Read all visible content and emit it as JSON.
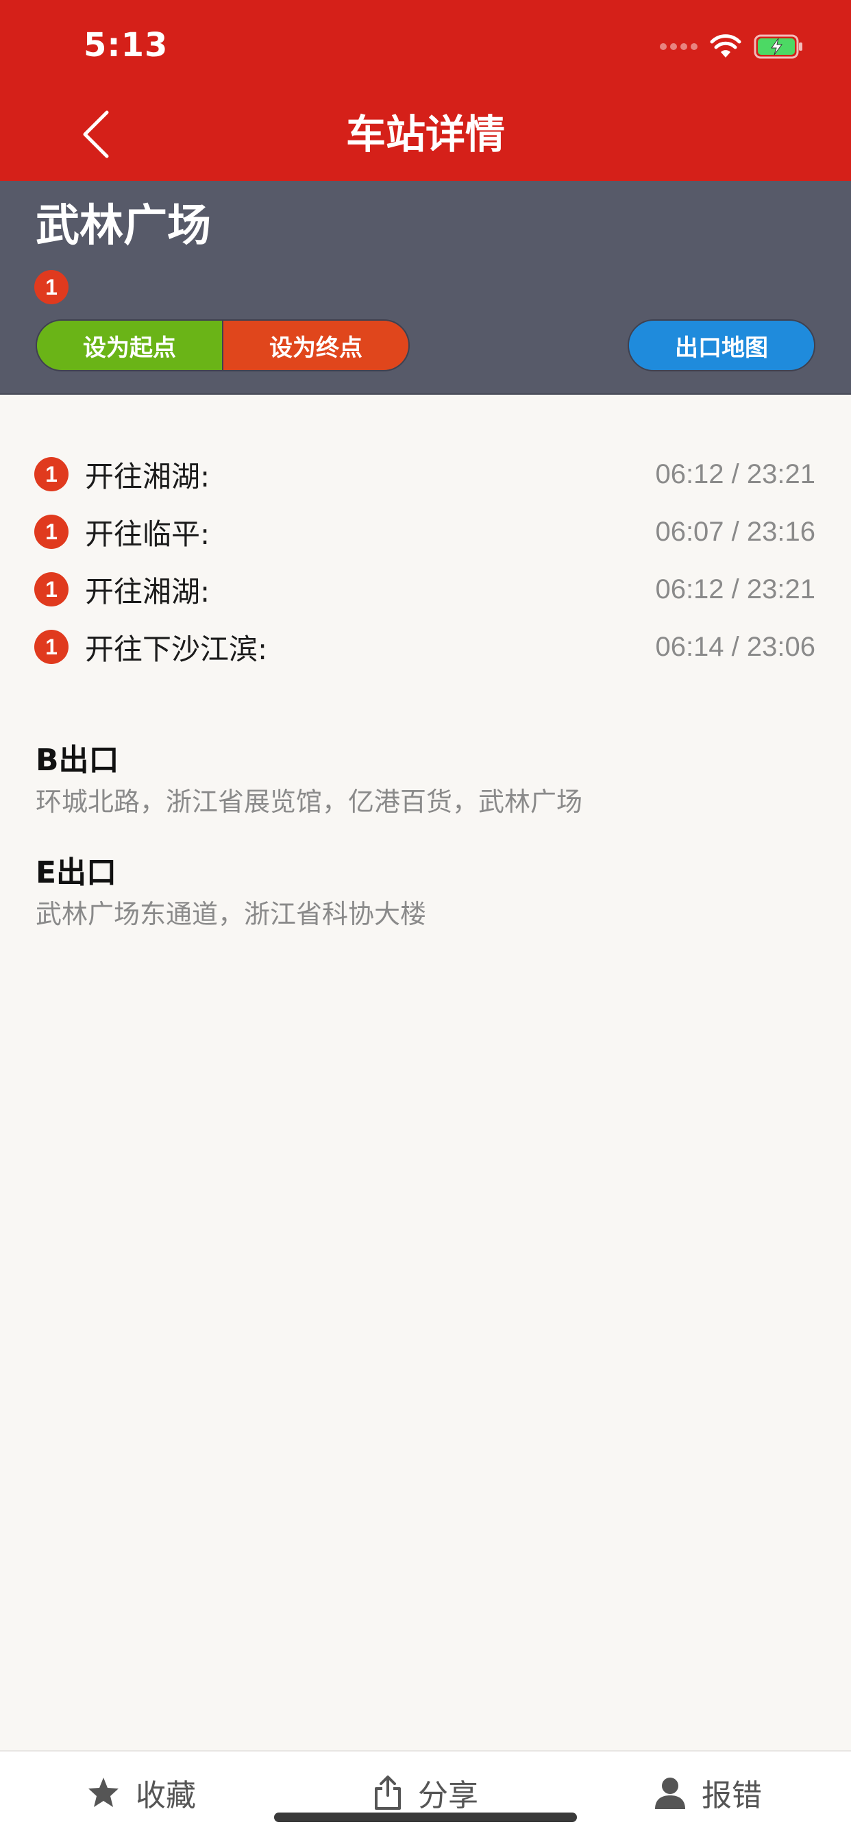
{
  "status_bar": {
    "time": "5:13"
  },
  "nav": {
    "title": "车站详情"
  },
  "station": {
    "name": "武林广场",
    "line_number": "1",
    "set_start_label": "设为起点",
    "set_end_label": "设为终点",
    "exit_map_label": "出口地图"
  },
  "schedule": [
    {
      "line": "1",
      "direction": "开往湘湖:",
      "times": "06:12 / 23:21"
    },
    {
      "line": "1",
      "direction": "开往临平:",
      "times": "06:07 / 23:16"
    },
    {
      "line": "1",
      "direction": "开往湘湖:",
      "times": "06:12 / 23:21"
    },
    {
      "line": "1",
      "direction": "开往下沙江滨:",
      "times": "06:14 / 23:06"
    }
  ],
  "exits": [
    {
      "name": "B出口",
      "description": "环城北路，浙江省展览馆，亿港百货，武林广场"
    },
    {
      "name": "E出口",
      "description": "武林广场东通道，浙江省科协大楼"
    }
  ],
  "tabbar": {
    "favorite_label": "收藏",
    "share_label": "分享",
    "report_label": "报错"
  },
  "colors": {
    "header_red": "#d52019",
    "station_panel": "#575a69",
    "line1_badge": "#e03a1e",
    "start_green": "#6ab417",
    "end_orange": "#e0461c",
    "exit_map_blue": "#1f8bdc"
  },
  "icons": {
    "back": "chevron-left-icon",
    "wifi": "wifi-icon",
    "battery": "battery-charging-icon",
    "favorite": "star-icon",
    "share": "share-icon",
    "report": "person-icon"
  }
}
